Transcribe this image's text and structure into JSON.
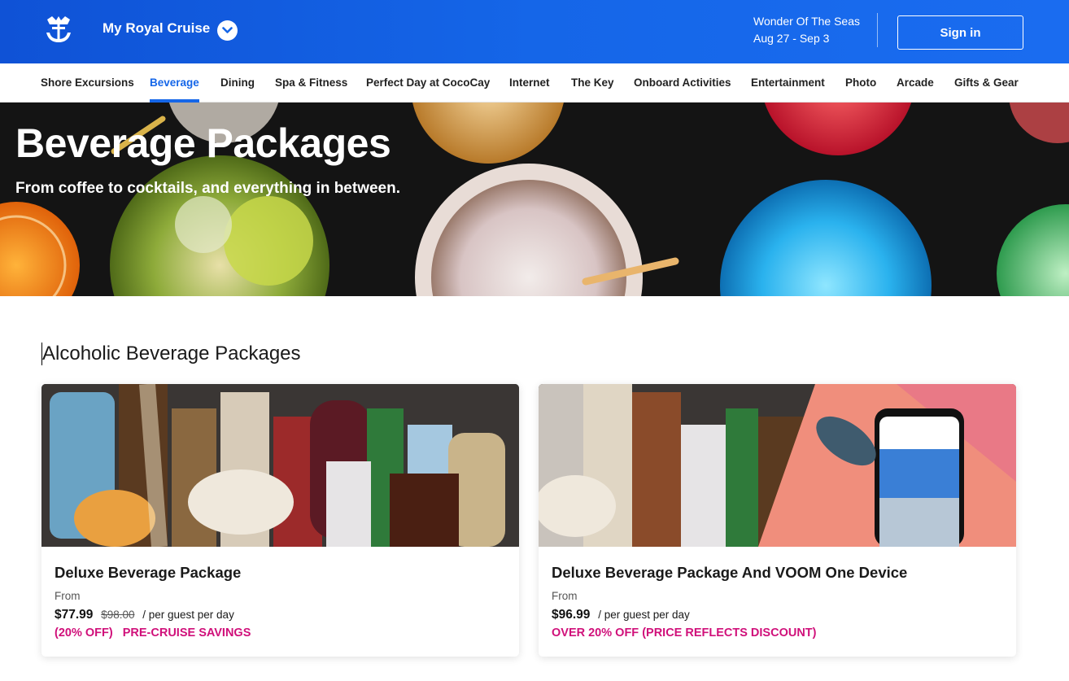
{
  "header": {
    "cruise_label": "My Royal Cruise",
    "ship_name": "Wonder Of The Seas",
    "dates": "Aug 27 - Sep 3",
    "signin_label": "Sign in"
  },
  "nav": {
    "items": [
      {
        "label": "Shore Excursions",
        "active": false
      },
      {
        "label": "Beverage",
        "active": true
      },
      {
        "label": "Dining",
        "active": false
      },
      {
        "label": "Spa & Fitness",
        "active": false
      },
      {
        "label": "Perfect Day at CocoCay",
        "active": false
      },
      {
        "label": "Internet",
        "active": false
      },
      {
        "label": "The Key",
        "active": false
      },
      {
        "label": "Onboard Activities",
        "active": false
      },
      {
        "label": "Entertainment",
        "active": false
      },
      {
        "label": "Photo",
        "active": false
      },
      {
        "label": "Arcade",
        "active": false
      },
      {
        "label": "Gifts & Gear",
        "active": false
      }
    ]
  },
  "hero": {
    "title": "Beverage Packages",
    "subtitle": "From coffee to cocktails, and everything in between."
  },
  "section": {
    "title": "Alcoholic Beverage Packages"
  },
  "cards": [
    {
      "title": "Deluxe Beverage Package",
      "from_label": "From",
      "price": "$77.99",
      "original_price": "$98.00",
      "unit": "/ per guest per day",
      "discount": "(20% OFF)",
      "promo": "PRE-CRUISE SAVINGS"
    },
    {
      "title": "Deluxe Beverage Package And VOOM One Device",
      "from_label": "From",
      "price": "$96.99",
      "unit": "/ per guest per day",
      "promo": "OVER 20% OFF (PRICE REFLECTS DISCOUNT)"
    }
  ],
  "colors": {
    "brand_blue": "#1566e8",
    "promo_pink": "#d0107a"
  },
  "icons": {
    "logo": "crown-anchor-logo-icon",
    "cruise_dropdown": "chevron-down-icon"
  }
}
